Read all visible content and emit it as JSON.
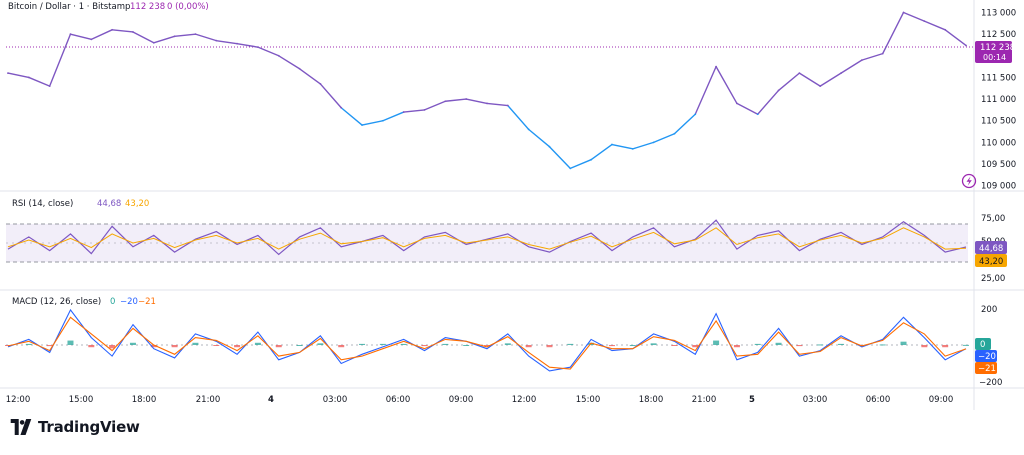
{
  "header": {
    "symbol": "Bitcoin / Dollar · 1 · Bitstamp",
    "last": "112 238",
    "change": "0 (0,00%)"
  },
  "colors": {
    "up": "#26a69a",
    "down": "#ef5350",
    "price_high": "#7e57c2",
    "price_low": "#2196f3",
    "rsi": "#7e57c2",
    "rsi_ma": "#f7a600",
    "macd": "#2962ff",
    "signal": "#ff6d00",
    "tag_price": "#9c27b0"
  },
  "price_panel": {
    "yticks": [
      "113 000",
      "112 500",
      "111 500",
      "111 000",
      "110 500",
      "110 000",
      "109 500",
      "109 000"
    ],
    "ytick_values": [
      113000,
      112500,
      111500,
      111000,
      110500,
      110000,
      109500,
      109000
    ],
    "last_tag": "112 238",
    "countdown": "00:14"
  },
  "rsi_panel": {
    "title": "RSI (14, close)",
    "value1": "44,68",
    "value2": "43,20",
    "yticks": [
      "75,00",
      "50,00",
      "25,00"
    ],
    "tag1": "44,68",
    "tag2": "43,20"
  },
  "macd_panel": {
    "title": "MACD (12, 26, close)",
    "v_hist": "0",
    "v_macd": "−20",
    "v_signal": "−21",
    "yticks": [
      "200",
      "−200"
    ],
    "tags": [
      "0",
      "−20",
      "−21"
    ]
  },
  "xaxis": {
    "labels": [
      "12:00",
      "15:00",
      "18:00",
      "21:00",
      "4",
      "03:00",
      "06:00",
      "09:00",
      "12:00",
      "15:00",
      "18:00",
      "21:00",
      "5",
      "03:00",
      "06:00",
      "09:00"
    ]
  },
  "brand": {
    "name": "TradingView",
    "logo_icon": "tradingview-logo-icon"
  },
  "icons": {
    "alert": "alert-bolt-icon"
  },
  "chart_data": [
    {
      "type": "line",
      "title": "Bitcoin / Dollar · 1 · Bitstamp",
      "xlabel": "",
      "ylabel": "",
      "ylim": [
        108900,
        113150
      ],
      "grid": false,
      "x": [
        "12:00",
        "13:00",
        "14:00",
        "15:00",
        "16:00",
        "17:00",
        "18:00",
        "19:00",
        "20:00",
        "21:00",
        "22:00",
        "23:00",
        "00:00",
        "01:00",
        "02:00",
        "03:00",
        "04:00",
        "05:00",
        "06:00",
        "07:00",
        "08:00",
        "09:00",
        "10:00",
        "11:00",
        "12:00",
        "13:00",
        "14:00",
        "15:00",
        "16:00",
        "17:00",
        "18:00",
        "19:00",
        "20:00",
        "21:00",
        "22:00",
        "23:00",
        "00:00",
        "01:00",
        "02:00",
        "03:00",
        "04:00",
        "05:00",
        "06:00",
        "07:00",
        "08:00",
        "09:00",
        "10:00"
      ],
      "series": [
        {
          "values": [
            111600,
            111500,
            111300,
            112500,
            112380,
            112600,
            112550,
            112300,
            112450,
            112500,
            112350,
            112280,
            112200,
            112000,
            111700,
            111350,
            110800,
            110400,
            110500,
            110700,
            110750,
            110950,
            111000,
            110900,
            110850,
            110300,
            109900,
            109400,
            109600,
            109950,
            109850,
            110000,
            110200,
            110650,
            111750,
            110900,
            110650,
            111200,
            111600,
            111300,
            111600,
            111900,
            112050,
            113000,
            112800,
            112600,
            112238
          ]
        }
      ]
    },
    {
      "type": "line",
      "title": "RSI (14, close)",
      "ylim": [
        20,
        85
      ],
      "series": [
        {
          "values": [
            42,
            58,
            40,
            62,
            36,
            72,
            45,
            60,
            38,
            55,
            65,
            48,
            60,
            35,
            58,
            70,
            45,
            52,
            60,
            40,
            58,
            64,
            48,
            55,
            62,
            45,
            38,
            52,
            63,
            40,
            58,
            70,
            45,
            55,
            80,
            42,
            60,
            66,
            40,
            55,
            64,
            48,
            58,
            78,
            60,
            38,
            44.68
          ]
        },
        {
          "values": [
            45,
            54,
            45,
            56,
            44,
            62,
            50,
            56,
            44,
            54,
            60,
            50,
            56,
            42,
            55,
            63,
            49,
            52,
            57,
            45,
            56,
            60,
            50,
            54,
            58,
            48,
            42,
            51,
            59,
            45,
            55,
            64,
            49,
            54,
            70,
            48,
            57,
            62,
            45,
            54,
            60,
            50,
            56,
            70,
            58,
            42,
            43.2
          ]
        }
      ]
    },
    {
      "type": "line",
      "title": "MACD (12, 26, close)",
      "ylim": [
        -230,
        230
      ],
      "series": [
        {
          "values": [
            -10,
            30,
            -40,
            190,
            40,
            -60,
            110,
            -20,
            -70,
            60,
            20,
            -50,
            70,
            -80,
            -40,
            50,
            -100,
            -50,
            -10,
            30,
            -30,
            40,
            20,
            -20,
            60,
            -60,
            -140,
            -120,
            30,
            -30,
            -20,
            60,
            20,
            -50,
            170,
            -80,
            -40,
            90,
            -60,
            -30,
            50,
            -10,
            30,
            150,
            40,
            -80,
            -20
          ]
        },
        {
          "values": [
            -5,
            20,
            -30,
            150,
            60,
            -30,
            90,
            0,
            -50,
            40,
            25,
            -30,
            50,
            -60,
            -40,
            35,
            -80,
            -60,
            -20,
            20,
            -20,
            30,
            20,
            -10,
            45,
            -40,
            -120,
            -130,
            10,
            -20,
            -20,
            45,
            25,
            -30,
            130,
            -60,
            -50,
            70,
            -50,
            -35,
            40,
            -5,
            25,
            120,
            60,
            -60,
            -21
          ]
        }
      ]
    }
  ]
}
